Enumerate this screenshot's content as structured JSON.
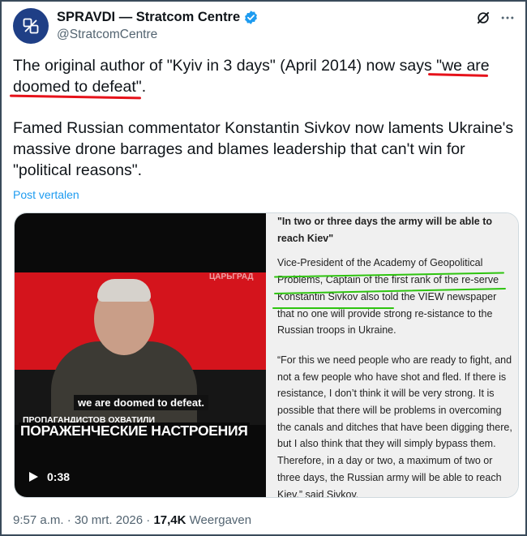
{
  "account": {
    "display_name": "SPRAVDI — Stratcom Centre",
    "handle": "@StratcomCentre",
    "verified": true,
    "avatar_color": "#1f3f86"
  },
  "header_icons": [
    "grok-icon",
    "more-icon"
  ],
  "tweet": {
    "para1": "The original author of \"Kyiv in 3 days\" (April 2014) now says \"we are doomed to defeat\".",
    "para2": "Famed Russian commentator Konstantin Sivkov now laments Ukraine's massive drone barrages and blames leadership that can't win for \"political reasons\".",
    "translate_label": "Post vertalen",
    "highlight_color": "#e6121a"
  },
  "video": {
    "subtitle": "we are doomed to defeat.",
    "caption_small": "ПРОПАГАНДИСТОВ ОХВАТИЛИ",
    "caption_big": "ПОРАЖЕНЧЕСКИЕ НАСТРОЕНИЯ",
    "duration": "0:38",
    "brand_mark": "ЦАРЬГРАД"
  },
  "article": {
    "heading": "\"In two or three days the army will be able to reach Kiev\"",
    "p1": "Vice-President of the Academy of Geopolitical Problems, Captain of the first rank of the re-serve Konstantin Sivkov also told the VIEW newspaper that no one will provide strong re-sistance to the Russian troops in Ukraine.",
    "p2": "“For this we need people who are ready to fight, and not a few people who have shot and fled. If there is resistance, I don’t think it will be very strong. It is possible that there will be problems in overcoming the canals and ditches that have been digging there, but I also think that they will simply bypass them. Therefore, in a day or two, a maximum of two or three days, the Russian army will be able to reach Kiev,” said Sivkov.",
    "highlight_color": "#2ec40f"
  },
  "footer": {
    "time": "9:57 a.m.",
    "date": "30 mrt. 2026",
    "views_count": "17,4K",
    "views_label": "Weergaven"
  }
}
